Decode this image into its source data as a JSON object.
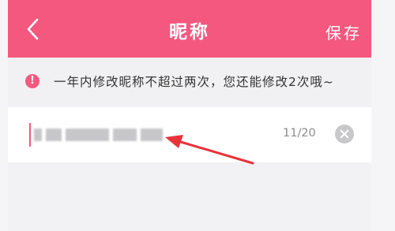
{
  "header": {
    "title": "昵称",
    "save_label": "保存",
    "background": "#f4587f"
  },
  "notice": {
    "icon": "exclamation-icon",
    "text": "一年内修改昵称不超过两次，您还能修改2次哦~"
  },
  "nickname_field": {
    "value_hidden": true,
    "char_count": "11/20",
    "clear_icon": "clear-icon"
  },
  "annotation": {
    "arrow_color": "#e8333a",
    "points_to": "nickname-input"
  }
}
